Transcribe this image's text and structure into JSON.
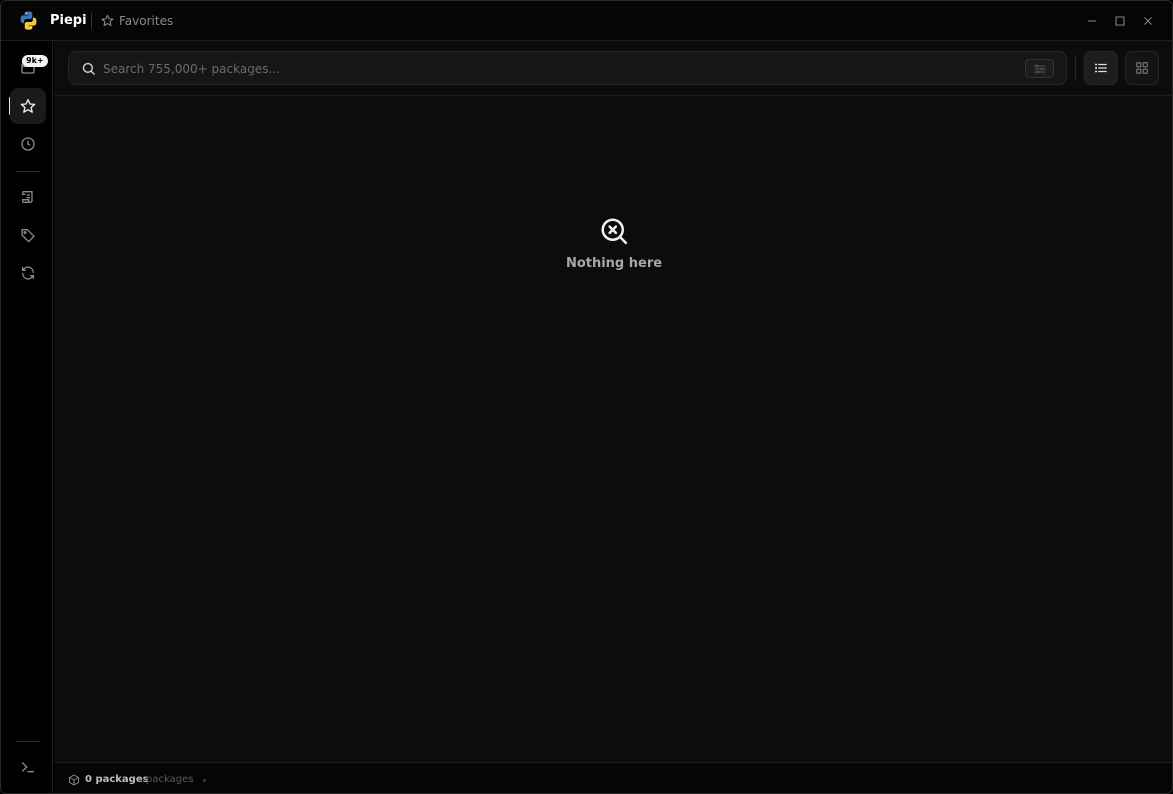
{
  "app": {
    "name": "Piepi",
    "breadcrumb": "Favorites",
    "accent": "#e6e6e6"
  },
  "window_controls": {
    "minimize_icon": "minimize-icon",
    "maximize_icon": "maximize-icon",
    "close_icon": "close-icon"
  },
  "sidebar": {
    "items": [
      {
        "id": "packages",
        "icon": "package-icon",
        "badge": "9k+"
      },
      {
        "id": "favorites",
        "icon": "star-icon",
        "active": true
      },
      {
        "id": "history",
        "icon": "clock-icon"
      },
      {
        "id": "scripts",
        "icon": "scroll-icon"
      },
      {
        "id": "tags",
        "icon": "tag-icon"
      },
      {
        "id": "updates",
        "icon": "refresh-icon"
      },
      {
        "id": "terminal",
        "icon": "terminal-icon"
      }
    ]
  },
  "search": {
    "placeholder": "Search 755,000+ packages...",
    "value": ""
  },
  "view_modes": [
    "list",
    "grid"
  ],
  "empty_state": {
    "message": "Nothing here",
    "icon": "search-x-icon"
  },
  "status": {
    "count": "0 packages",
    "unit": "packages"
  }
}
